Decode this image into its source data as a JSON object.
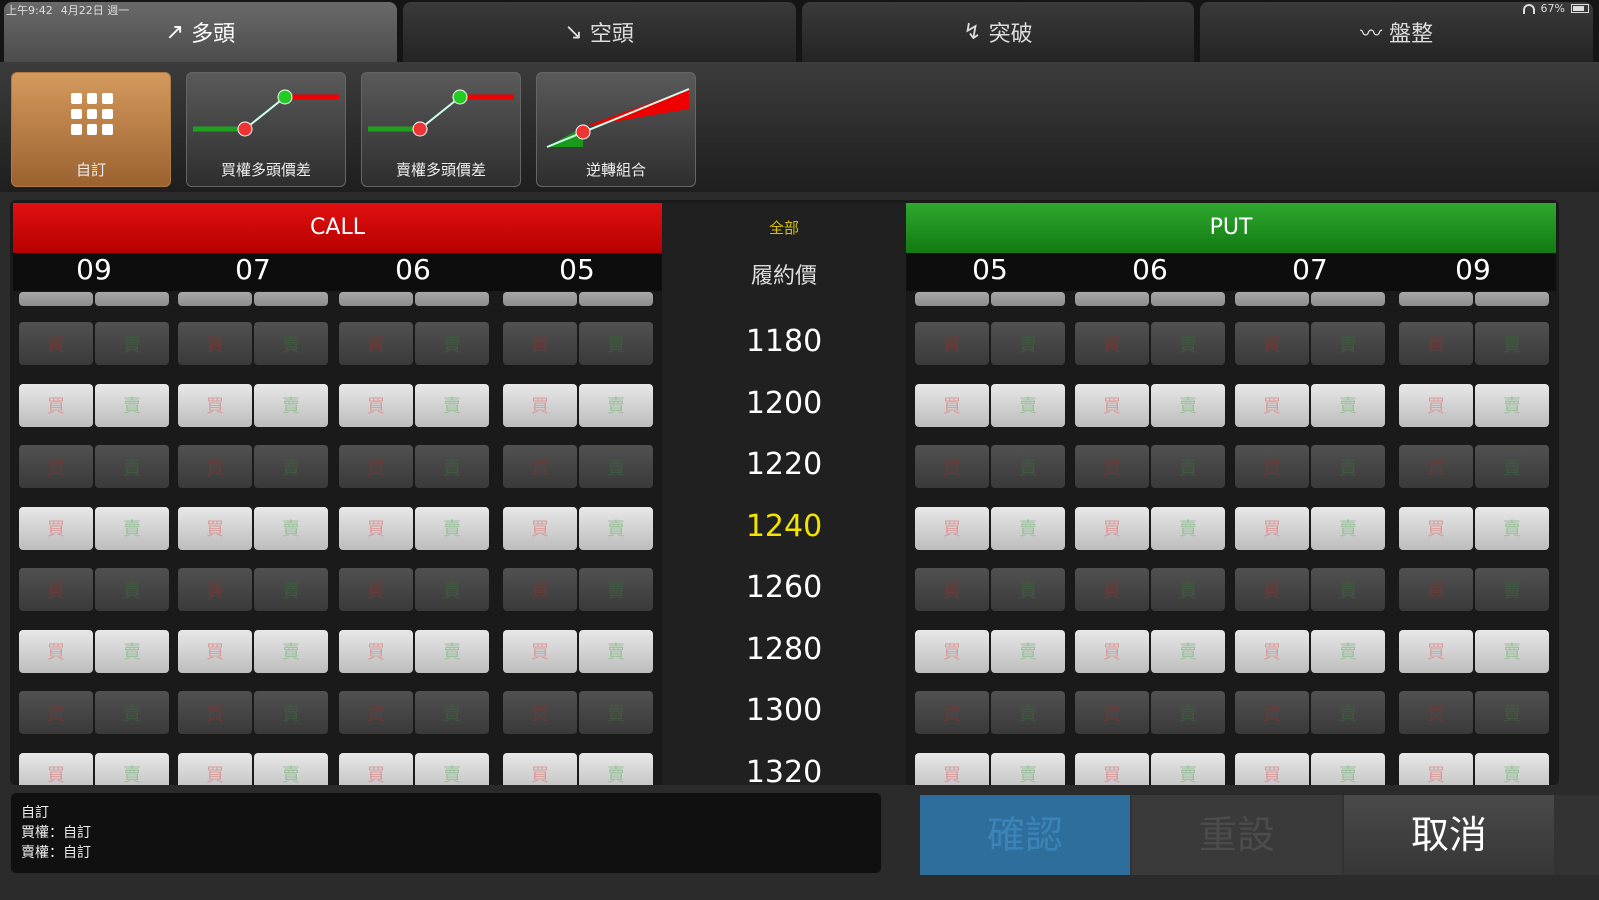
{
  "status": {
    "time": "上午9:42",
    "date": "4月22日 週一",
    "battery": "67%"
  },
  "tabs": [
    {
      "label": "多頭",
      "icon": "↗"
    },
    {
      "label": "空頭",
      "icon": "↘"
    },
    {
      "label": "突破",
      "icon": "↯"
    },
    {
      "label": "盤整",
      "icon": "〰"
    }
  ],
  "strategies": [
    {
      "label": "自訂",
      "icon": "grid-icon"
    },
    {
      "label": "買權多頭價差",
      "icon": "bull-call-spread-icon"
    },
    {
      "label": "賣權多頭價差",
      "icon": "bull-put-spread-icon"
    },
    {
      "label": "逆轉組合",
      "icon": "reversal-icon"
    }
  ],
  "table": {
    "call_label": "CALL",
    "put_label": "PUT",
    "all_label": "全部",
    "strike_header": "履約價",
    "call_months": [
      "09",
      "07",
      "06",
      "05"
    ],
    "put_months": [
      "05",
      "06",
      "07",
      "09"
    ],
    "buy_label": "買",
    "sell_label": "賣",
    "strikes": [
      "1180",
      "1200",
      "1220",
      "1240",
      "1260",
      "1280",
      "1300",
      "1320"
    ],
    "atm_strike": "1240"
  },
  "info": {
    "line1": "自訂",
    "line2": "買權：自訂",
    "line3": "賣權：自訂"
  },
  "actions": {
    "confirm": "確認",
    "reset": "重設",
    "cancel": "取消"
  },
  "colors": {
    "call": "#d40000",
    "put": "#1f8f1f",
    "atm": "#f2e400",
    "custom": "#c4854a",
    "confirm": "#2e6e9c"
  }
}
